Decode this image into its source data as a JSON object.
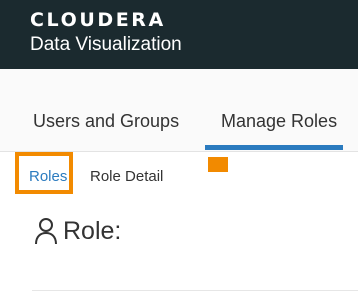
{
  "header": {
    "brand": "CLOUDERA",
    "product": "Data Visualization",
    "background": "#1b2a2f"
  },
  "tabs": [
    {
      "label": "Users and Groups",
      "active": false
    },
    {
      "label": "Manage Roles",
      "active": true
    }
  ],
  "breadcrumbs": {
    "roles": "Roles",
    "role_detail": "Role Detail"
  },
  "role": {
    "icon": "user-icon",
    "title": "Role:"
  },
  "colors": {
    "accent": "#2b7bbf",
    "highlight": "#f28a00"
  }
}
